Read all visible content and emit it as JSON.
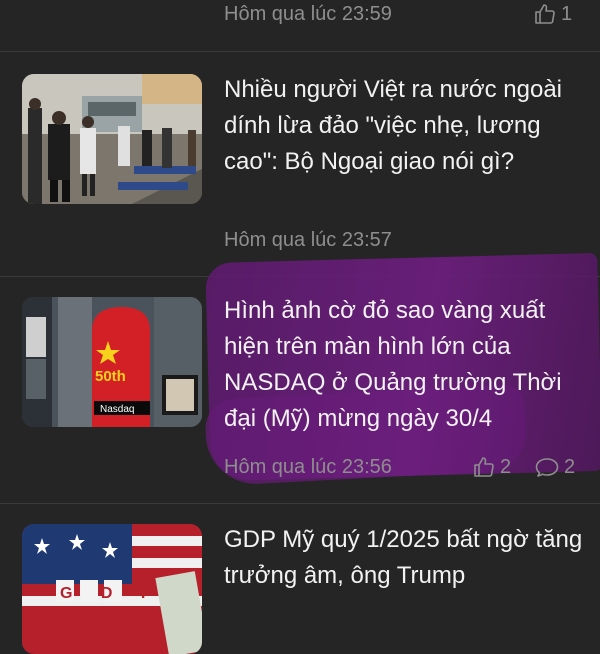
{
  "articles": [
    {
      "time": "Hôm qua lúc 23:59",
      "likes": "1"
    },
    {
      "headline": "Nhiều người Việt ra nước ngoài dính lừa đảo \"việc nhẹ, lương cao\": Bộ Ngoại giao nói gì?",
      "time": "Hôm qua lúc 23:57"
    },
    {
      "headline": "Hình ảnh cờ đỏ sao vàng xuất hiện trên màn hình lớn của NASDAQ ở Quảng trường Thời đại (Mỹ) mừng ngày 30/4",
      "time": "Hôm qua lúc 23:56",
      "likes": "2",
      "comments": "2",
      "thumb_text": {
        "anniversary": "50th",
        "exchange": "Nasdaq"
      }
    },
    {
      "headline": "GDP Mỹ quý 1/2025 bất ngờ tăng trưởng âm, ông Trump",
      "thumb_text": "G D P"
    }
  ],
  "colors": {
    "background": "#252525",
    "headline": "#f2f2f2",
    "meta": "#8e8e8e",
    "highlight": "#6e1e80"
  }
}
